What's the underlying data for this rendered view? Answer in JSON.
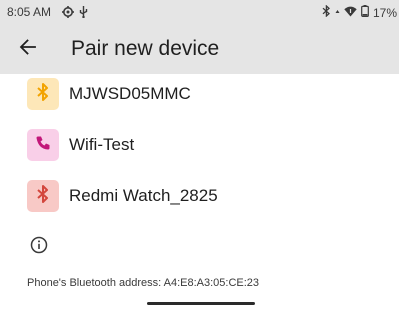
{
  "status_bar": {
    "time": "8:05 AM",
    "battery_text": "17%",
    "icons": [
      "settings-gear-icon",
      "usb-debug-icon",
      "bluetooth-icon",
      "data-arrow-icon",
      "wifi-icon",
      "battery-icon"
    ]
  },
  "header": {
    "back_icon": "arrow-back-icon",
    "title": "Pair new device"
  },
  "devices": [
    {
      "name": "MJWSD05MMC",
      "icon": "bluetooth-icon",
      "icon_bg": "#fde7b8",
      "icon_color": "#f2a300"
    },
    {
      "name": "Wifi-Test",
      "icon": "phone-icon",
      "icon_bg": "#f9cfe8",
      "icon_color": "#c2187a"
    },
    {
      "name": "Redmi Watch_2825",
      "icon": "bluetooth-icon",
      "icon_bg": "#f8c9c6",
      "icon_color": "#d3463d"
    }
  ],
  "footer": {
    "info_icon": "info-icon",
    "bluetooth_address_text": "Phone's Bluetooth address: A4:E8:A3:05:CE:23"
  }
}
